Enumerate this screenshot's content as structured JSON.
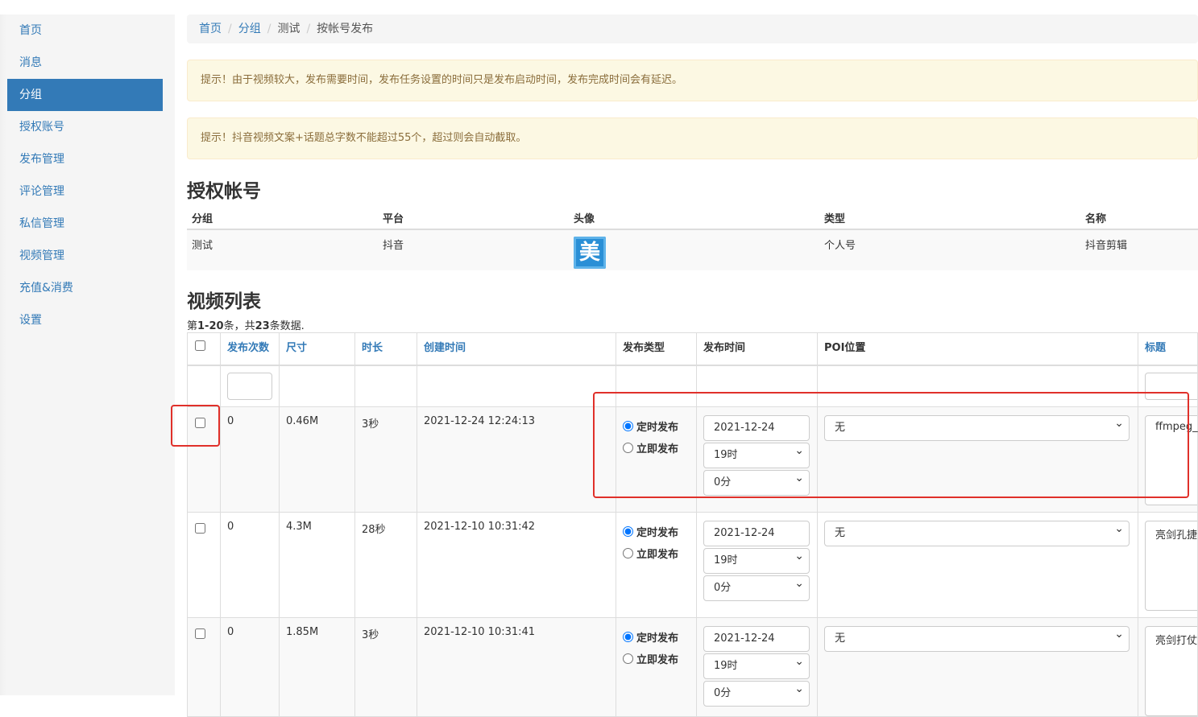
{
  "sidebar": {
    "items": [
      {
        "label": "首页",
        "active": false
      },
      {
        "label": "消息",
        "active": false
      },
      {
        "label": "分组",
        "active": true
      },
      {
        "label": "授权账号",
        "active": false
      },
      {
        "label": "发布管理",
        "active": false
      },
      {
        "label": "评论管理",
        "active": false
      },
      {
        "label": "私信管理",
        "active": false
      },
      {
        "label": "视频管理",
        "active": false
      },
      {
        "label": "充值&消费",
        "active": false
      },
      {
        "label": "设置",
        "active": false
      }
    ]
  },
  "breadcrumb": {
    "home": "首页",
    "group": "分组",
    "test": "测试",
    "current": "按帐号发布",
    "sep": "/"
  },
  "alerts": [
    "提示！由于视频较大，发布需要时间，发布任务设置的时间只是发布启动时间，发布完成时间会有延迟。",
    "提示！抖音视频文案+话题总字数不能超过55个，超过则会自动截取。"
  ],
  "account_section": {
    "title": "授权帐号",
    "headers": {
      "group": "分组",
      "platform": "平台",
      "avatar": "头像",
      "type": "类型",
      "name": "名称"
    },
    "row": {
      "group": "测试",
      "platform": "抖音",
      "avatar_char": "美",
      "type": "个人号",
      "name": "抖音剪辑"
    }
  },
  "video_section": {
    "title": "视频列表",
    "summary_prefix": "第",
    "summary_range": "1-20",
    "summary_mid": "条，共",
    "summary_total": "23",
    "summary_suffix": "条数据.",
    "headers": {
      "count": "发布次数",
      "size": "尺寸",
      "duration": "时长",
      "created": "创建时间",
      "pub_type": "发布类型",
      "pub_time": "发布时间",
      "poi": "POI位置",
      "title": "标题"
    },
    "radio_scheduled": "定时发布",
    "radio_now": "立即发布",
    "rows": [
      {
        "count": "0",
        "size": "0.46M",
        "duration": "3秒",
        "created": "2021-12-24 12:24:13",
        "date": "2021-12-24",
        "hour": "19时",
        "minute": "0分",
        "poi": "无",
        "title": "ffmpeg_n"
      },
      {
        "count": "0",
        "size": "4.3M",
        "duration": "28秒",
        "created": "2021-12-10 10:31:42",
        "date": "2021-12-24",
        "hour": "19时",
        "minute": "0分",
        "poi": "无",
        "title": "亮剑孔捷"
      },
      {
        "count": "0",
        "size": "1.85M",
        "duration": "3秒",
        "created": "2021-12-10 10:31:41",
        "date": "2021-12-24",
        "hour": "19时",
        "minute": "0分",
        "poi": "无",
        "title": "亮剑打仗"
      }
    ]
  },
  "colors": {
    "accent": "#337ab7",
    "alert_bg": "#fcf8e3",
    "alert_text": "#8a6d3b",
    "highlight": "#e0302a"
  }
}
